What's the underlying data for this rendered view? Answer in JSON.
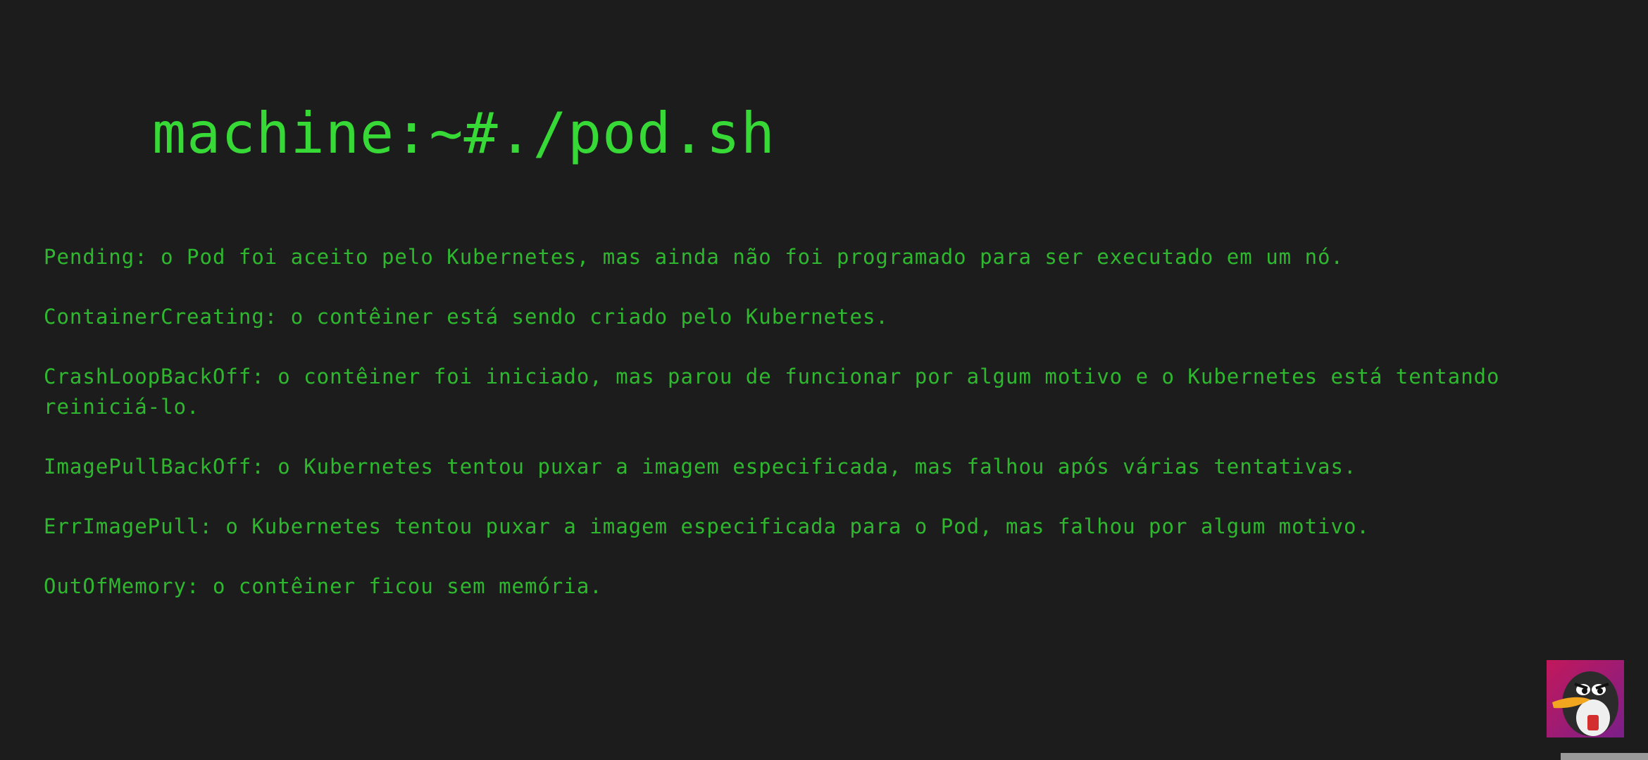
{
  "terminal": {
    "prompt": "machine:~#./pod.sh",
    "lines": [
      "Pending: o Pod foi aceito pelo Kubernetes, mas ainda não foi programado para ser executado em um nó.",
      "ContainerCreating: o contêiner está sendo criado pelo Kubernetes.",
      "CrashLoopBackOff: o contêiner foi iniciado, mas parou de funcionar por algum motivo e o Kubernetes está tentando reiniciá-lo.",
      "ImagePullBackOff: o Kubernetes tentou puxar a imagem especificada, mas falhou após várias tentativas.",
      "ErrImagePull: o Kubernetes tentou puxar a imagem especificada para o Pod, mas falhou por algum motivo.",
      "OutOfMemory: o contêiner ficou sem memória."
    ]
  },
  "icons": {
    "channel_avatar": "penguin-avatar-icon"
  },
  "colors": {
    "background": "#1c1c1c",
    "text_green": "#35d435",
    "avatar_bg": "#d8266e"
  }
}
